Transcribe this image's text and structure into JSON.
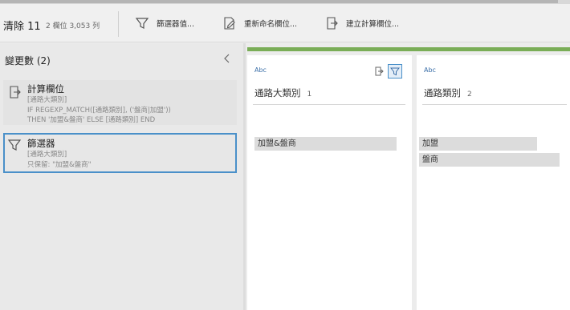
{
  "toolbar": {
    "title": "清除 11",
    "subtitle": "2 欄位  3,053 列",
    "filter_label": "篩選器值...",
    "rename_label": "重新命名欄位...",
    "calc_label": "建立計算欄位..."
  },
  "changes_panel": {
    "header": "變更數 (2)",
    "items": [
      {
        "title": "計算欄位",
        "lines": [
          "[通路大類別]",
          "IF REGEXP_MATCH([通路類別], ('盤商|加盟'))",
          "THEN '加盟&盤商' ELSE [通路類別] END"
        ],
        "icon": "calculated-field-icon"
      },
      {
        "title": "篩選器",
        "lines": [
          "[通路大類別]",
          "只保留: \"加盟&盤商\""
        ],
        "icon": "filter-icon"
      }
    ]
  },
  "columns": [
    {
      "type": "Abc",
      "name": "通路大類別",
      "number": "1",
      "values": [
        "加盟&盤商"
      ]
    },
    {
      "type": "Abc",
      "name": "通路類別",
      "number": "2",
      "values": [
        "加盟",
        "盤商"
      ]
    }
  ],
  "colors": {
    "accent": "#4a90c9",
    "green": "#7aad57"
  }
}
